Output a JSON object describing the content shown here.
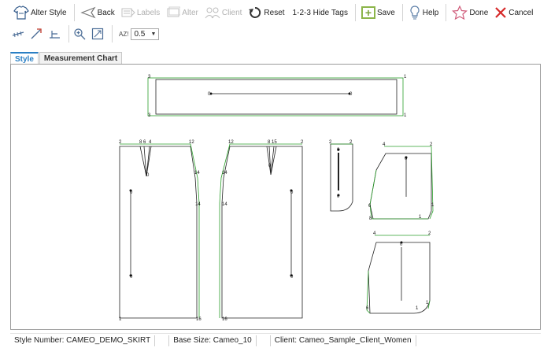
{
  "toolbar": {
    "alter_style": "Alter Style",
    "back": "Back",
    "labels": "Labels",
    "alter": "Alter",
    "client": "Client",
    "reset": "Reset",
    "hide_tags": "1-2-3 Hide Tags",
    "save": "Save",
    "help": "Help",
    "done": "Done",
    "cancel": "Cancel"
  },
  "toolbar2": {
    "size_label": "AZ!",
    "size_value": "0.5"
  },
  "tabs": [
    "Style",
    "Measurement Chart"
  ],
  "status": {
    "style_number": "Style Number: CAMEO_DEMO_SKIRT",
    "base_size": "Base Size: Cameo_10",
    "client": "Client: Cameo_Sample_Client_Women"
  },
  "pattern_labels": {
    "waistband": [
      "3",
      "1",
      "3",
      "1",
      "0",
      "0"
    ],
    "front": [
      "2",
      "8",
      "6",
      "4",
      "12",
      "0",
      "14",
      "14",
      "0",
      "0",
      "1",
      "16"
    ],
    "back": [
      "12",
      "8",
      "15",
      "2",
      "0",
      "14",
      "14",
      "0",
      "0",
      "16"
    ],
    "facing": [
      "2",
      "2",
      "0",
      "0"
    ],
    "pocket_top": [
      "4",
      "2",
      "0",
      "6",
      "1",
      "1",
      "8"
    ],
    "pocket_bottom": [
      "4",
      "2",
      "0",
      "6",
      "1",
      "1"
    ]
  },
  "colors": {
    "accent": "#2a7fc4",
    "seam_green": "#2ca02c",
    "cancel_red": "#d62828",
    "save_green": "#8cb54a"
  }
}
